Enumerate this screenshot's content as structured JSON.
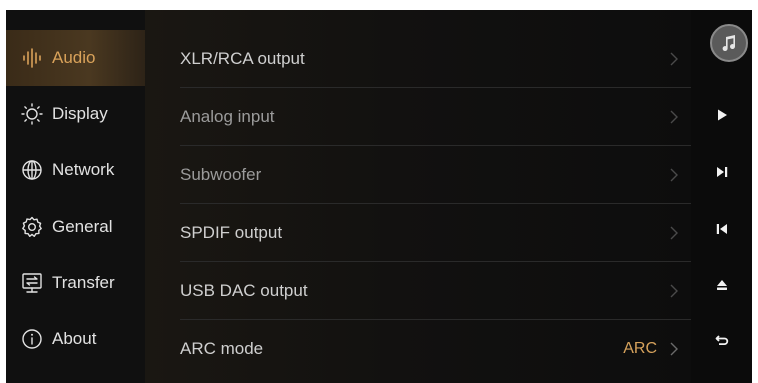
{
  "sidebar": {
    "items": [
      {
        "label": "Audio",
        "icon": "audio-waveform-icon",
        "active": true
      },
      {
        "label": "Display",
        "icon": "brightness-icon",
        "active": false
      },
      {
        "label": "Network",
        "icon": "globe-icon",
        "active": false
      },
      {
        "label": "General",
        "icon": "gear-icon",
        "active": false
      },
      {
        "label": "Transfer",
        "icon": "transfer-icon",
        "active": false
      },
      {
        "label": "About",
        "icon": "info-icon",
        "active": false
      }
    ]
  },
  "settings": {
    "rows": [
      {
        "label": "XLR/RCA output",
        "value": ""
      },
      {
        "label": "Analog input",
        "value": ""
      },
      {
        "label": "Subwoofer",
        "value": ""
      },
      {
        "label": "SPDIF output",
        "value": ""
      },
      {
        "label": "USB DAC output",
        "value": ""
      },
      {
        "label": "ARC mode",
        "value": "ARC"
      }
    ]
  },
  "controls": {
    "items": [
      "album-art-icon",
      "play-icon",
      "next-track-icon",
      "previous-track-icon",
      "eject-icon",
      "back-icon"
    ]
  },
  "colors": {
    "accent": "#d6a25c",
    "active_bg": "#4a3820",
    "background": "#0b0b0b"
  }
}
